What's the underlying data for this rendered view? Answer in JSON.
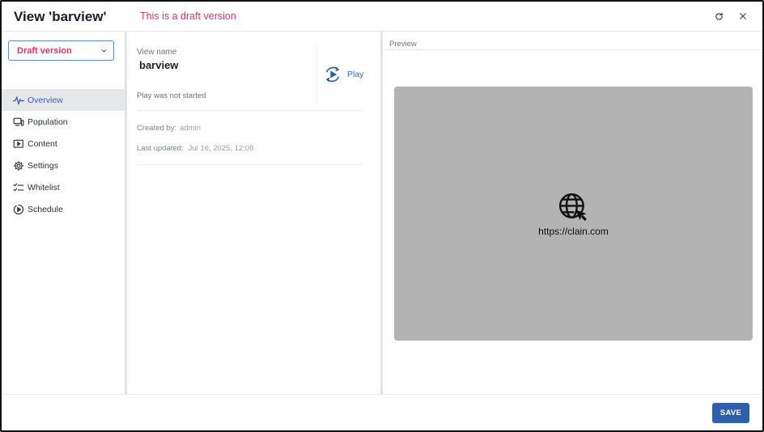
{
  "header": {
    "title": "View 'barview'",
    "draft_notice": "This is a draft version"
  },
  "sidebar": {
    "version_select": {
      "selected": "Draft version"
    },
    "items": [
      {
        "label": "Overview",
        "icon": "pulse-icon",
        "active": true
      },
      {
        "label": "Population",
        "icon": "devices-icon"
      },
      {
        "label": "Content",
        "icon": "media-icon"
      },
      {
        "label": "Settings",
        "icon": "gear-icon"
      },
      {
        "label": "Whitelist",
        "icon": "checklist-icon"
      },
      {
        "label": "Schedule",
        "icon": "play-schedule-icon"
      }
    ]
  },
  "overview": {
    "view_name_label": "View name",
    "view_name": "barview",
    "play_label": "Play",
    "play_status": "Play was not started",
    "created_by_label": "Created by:",
    "created_by": "admin",
    "last_updated_label": "Last updated:",
    "last_updated": "Jul 16, 2025, 12:08"
  },
  "preview": {
    "label": "Preview",
    "url": "https://clain.com"
  },
  "footer": {
    "save_label": "SAVE"
  },
  "colors": {
    "accent": "#3b63b8",
    "draft": "#e0336b",
    "save_button": "#2f5fa9",
    "preview_bg": "#b4b3b4"
  }
}
